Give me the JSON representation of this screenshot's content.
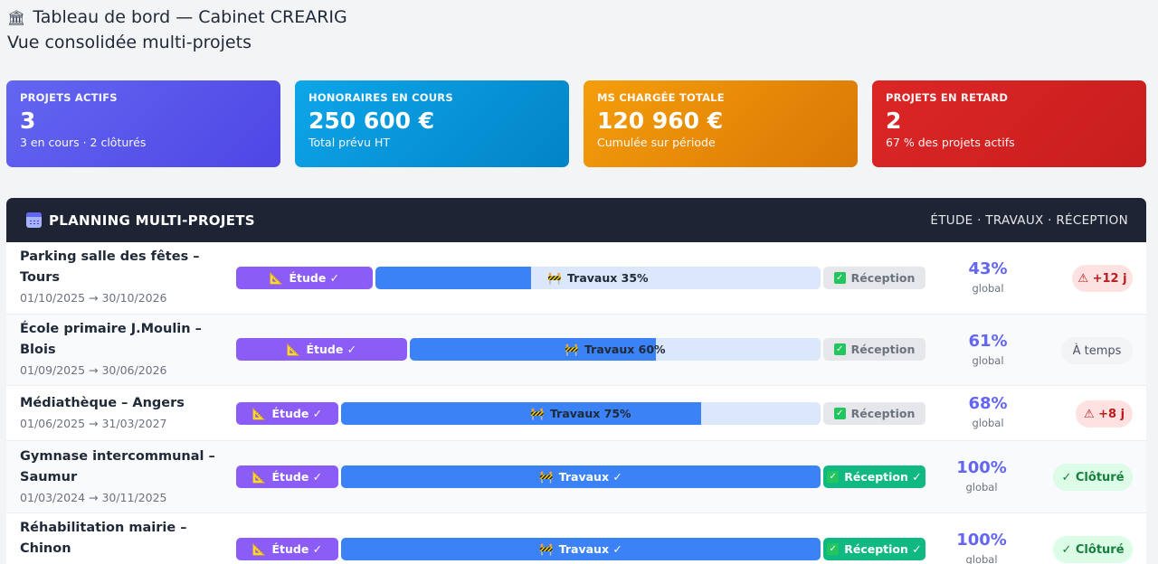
{
  "header": {
    "icon": "bank-icon",
    "title": "Tableau de bord — Cabinet CREARIG",
    "subtitle": "Vue consolidée multi-projets"
  },
  "kpis": [
    {
      "label": "PROJETS ACTIFS",
      "value": "3",
      "sub": "3 en cours · 2 clôturés",
      "color": "#5b57ea"
    },
    {
      "label": "HONORAIRES EN COURS",
      "value": "250 600 €",
      "sub": "Total prévu HT",
      "color": "#0ea5e9"
    },
    {
      "label": "MS CHARGÉE TOTALE",
      "value": "120 960 €",
      "sub": "Cumulée sur période",
      "color": "#f59e0b"
    },
    {
      "label": "PROJETS EN RETARD",
      "value": "2",
      "sub": "67 % des projets actifs",
      "color": "#dc2626"
    }
  ],
  "planning": {
    "title": "PLANNING MULTI-PROJETS",
    "legend": "ÉTUDE · TRAVAUX · RÉCEPTION",
    "global_label": "global",
    "projects": [
      {
        "name": "Parking salle des fêtes – Tours",
        "dates": "01/10/2025 → 30/10/2026",
        "etude": "Étude ✓",
        "travaux": "Travaux 35%",
        "travaux_progress": 0.35,
        "travaux_done": false,
        "reception": "Réception",
        "reception_done": false,
        "global": "43%",
        "status": "⚠ +12 j",
        "status_type": "late"
      },
      {
        "name": "École primaire J.Moulin – Blois",
        "dates": "01/09/2025 → 30/06/2026",
        "etude": "Étude ✓",
        "travaux": "Travaux 60%",
        "travaux_progress": 0.6,
        "travaux_done": false,
        "reception": "Réception",
        "reception_done": false,
        "global": "61%",
        "status": "À temps",
        "status_type": "ontime"
      },
      {
        "name": "Médiathèque – Angers",
        "dates": "01/06/2025 → 31/03/2027",
        "etude": "Étude ✓",
        "travaux": "Travaux 75%",
        "travaux_progress": 0.75,
        "travaux_done": false,
        "reception": "Réception",
        "reception_done": false,
        "global": "68%",
        "status": "⚠ +8 j",
        "status_type": "late"
      },
      {
        "name": "Gymnase intercommunal – Saumur",
        "dates": "01/03/2024 → 30/11/2025",
        "etude": "Étude ✓",
        "travaux": "Travaux ✓",
        "travaux_progress": 1,
        "travaux_done": true,
        "reception": "Réception ✓",
        "reception_done": true,
        "global": "100%",
        "status": "✓ Clôturé",
        "status_type": "closed"
      },
      {
        "name": "Réhabilitation mairie – Chinon",
        "dates": "",
        "etude": "Étude ✓",
        "travaux": "Travaux ✓",
        "travaux_progress": 1,
        "travaux_done": true,
        "reception": "Réception ✓",
        "reception_done": true,
        "global": "100%",
        "status": "✓ Clôturé",
        "status_type": "closed"
      }
    ]
  }
}
